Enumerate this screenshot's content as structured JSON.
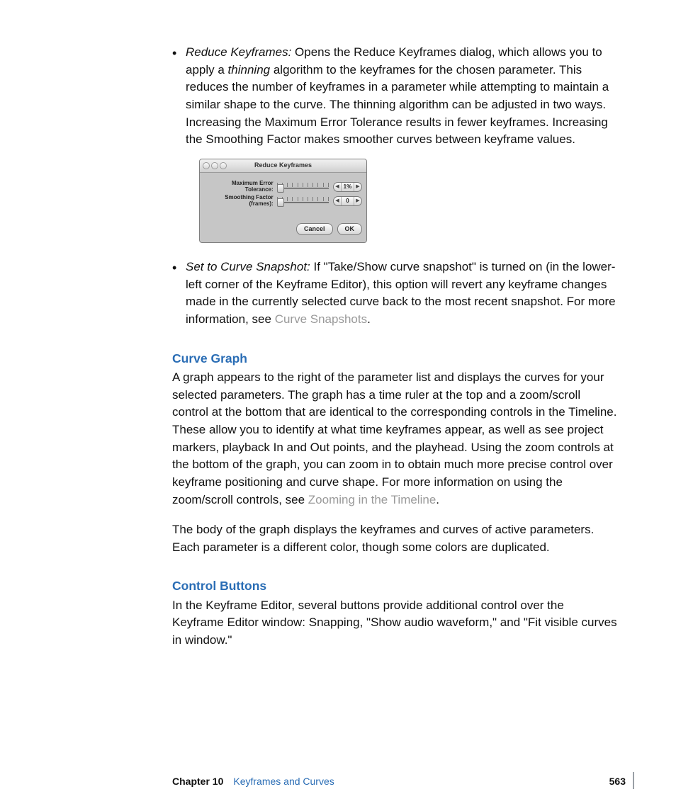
{
  "bullet1": {
    "term": "Reduce Keyframes:",
    "pre": "  Opens the Reduce Keyframes dialog, which allows you to apply a ",
    "italic": "thinning",
    "post": " algorithm to the keyframes for the chosen parameter. This reduces the number of keyframes in a parameter while attempting to maintain a similar shape to the curve. The thinning algorithm can be adjusted in two ways. Increasing the Maximum Error Tolerance results in fewer keyframes. Increasing the Smoothing Factor makes smoother curves between keyframe values."
  },
  "dialog": {
    "title": "Reduce Keyframes",
    "row1_label": "Maximum Error Tolerance:",
    "row1_value": "1%",
    "row2_label": "Smoothing Factor (frames):",
    "row2_value": "0",
    "btn_cancel": "Cancel",
    "btn_ok": "OK"
  },
  "bullet2": {
    "term": "Set to Curve Snapshot:",
    "body": "  If \"Take/Show curve snapshot\" is turned on (in the lower-left corner of the Keyframe Editor), this option will revert any keyframe changes made in the currently selected curve back to the most recent snapshot. For more information, see ",
    "link": "Curve Snapshots",
    "period": "."
  },
  "sectionA": {
    "heading": "Curve Graph",
    "p1_pre": "A graph appears to the right of the parameter list and displays the curves for your selected parameters. The graph has a time ruler at the top and a zoom/scroll control at the bottom that are identical to the corresponding controls in the Timeline. These allow you to identify at what time keyframes appear, as well as see project markers, playback In and Out points, and the playhead. Using the zoom controls at the bottom of the graph, you can zoom in to obtain much more precise control over keyframe positioning and curve shape. For more information on using the zoom/scroll controls, see ",
    "p1_link": "Zooming in the Timeline",
    "p1_period": ".",
    "p2": "The body of the graph displays the keyframes and curves of active parameters. Each parameter is a different color, though some colors are duplicated."
  },
  "sectionB": {
    "heading": "Control Buttons",
    "p1": "In the Keyframe Editor, several buttons provide additional control over the Keyframe Editor window: Snapping, \"Show audio waveform,\" and \"Fit visible curves in window.\""
  },
  "footer": {
    "chapter": "Chapter 10",
    "title": "Keyframes and Curves",
    "page": "563"
  }
}
